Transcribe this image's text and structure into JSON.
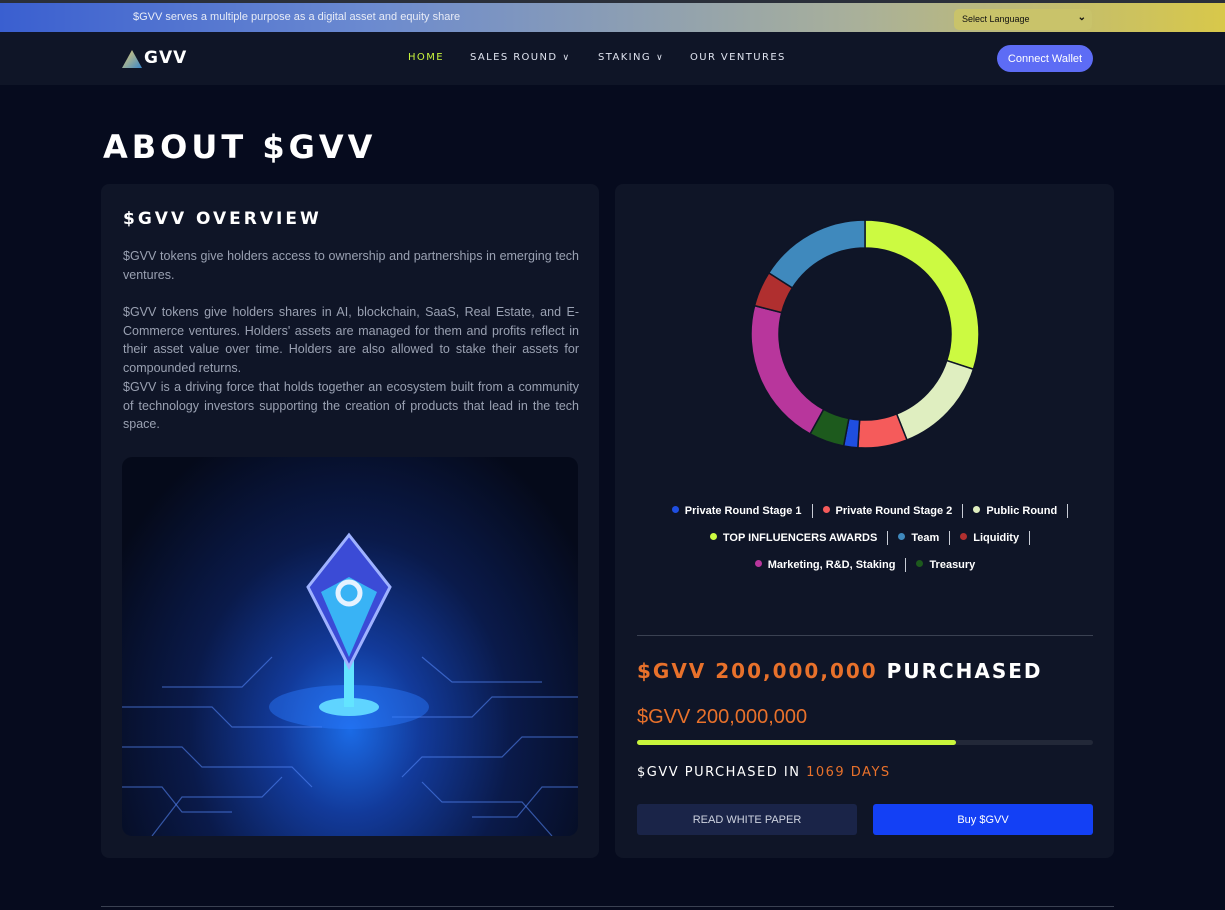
{
  "topbar": {
    "announcement": "$GVV serves a multiple purpose as a digital asset and equity share",
    "language_select": "Select Language"
  },
  "nav": {
    "logo_text": "GVV",
    "links": [
      {
        "label": "HOME",
        "active": true
      },
      {
        "label": "SALES ROUND",
        "dropdown": true
      },
      {
        "label": "STAKING",
        "dropdown": true
      },
      {
        "label": "OUR VENTURES"
      }
    ],
    "connect_label": "Connect Wallet"
  },
  "page": {
    "title": "ABOUT $GVV"
  },
  "overview": {
    "title": "$GVV OVERVIEW",
    "paragraphs": [
      "$GVV tokens give holders access to ownership and partnerships in emerging tech ventures.",
      "$GVV tokens give holders shares in AI, blockchain, SaaS, Real Estate, and E-Commerce ventures. Holders' assets are managed for them and profits reflect in their asset value over time. Holders are also allowed to stake their assets for compounded returns.",
      "$GVV is a driving force that holds together an ecosystem built from a community of technology investors supporting the creation of products that lead in the tech space."
    ]
  },
  "chart_data": {
    "type": "pie",
    "variant": "donut",
    "slices": [
      {
        "label": "TOP INFLUENCERS AWARDS",
        "value": 30,
        "color": "#ccfa41"
      },
      {
        "label": "Public Round",
        "value": 14,
        "color": "#dfeec0"
      },
      {
        "label": "Private Round Stage 2",
        "value": 7,
        "color": "#f55b5b"
      },
      {
        "label": "Private Round Stage 1",
        "value": 2,
        "color": "#1f4ee0"
      },
      {
        "label": "Treasury",
        "value": 5,
        "color": "#1d5a1d"
      },
      {
        "label": "Marketing, R&D, Staking",
        "value": 21,
        "color": "#b8369c"
      },
      {
        "label": "Liquidity",
        "value": 5,
        "color": "#b02f2f"
      },
      {
        "label": "Team",
        "value": 16,
        "color": "#3f89bd"
      }
    ]
  },
  "legend": {
    "rows": [
      [
        {
          "label": "Private Round Stage 1",
          "color": "#1f4ee0"
        },
        {
          "label": "Private Round Stage 2",
          "color": "#f55b5b"
        },
        {
          "label": "Public Round",
          "color": "#dfeec0"
        }
      ],
      [
        {
          "label": "TOP INFLUENCERS AWARDS",
          "color": "#ccfa41"
        },
        {
          "label": "Team",
          "color": "#3f89bd"
        },
        {
          "label": "Liquidity",
          "color": "#b02f2f"
        }
      ],
      [
        {
          "label": "Marketing, R&D, Staking",
          "color": "#b8369c"
        },
        {
          "label": "Treasury",
          "color": "#1d5a1d"
        }
      ]
    ]
  },
  "sale": {
    "purchased_amount": "$GVV 200,000,000",
    "purchased_word": "PURCHASED",
    "amount": "$GVV 200,000,000",
    "progress": 0.7,
    "purchased_in_label": "$GVV PURCHASED IN",
    "days": "1069 DAYS",
    "whitepaper_label": "READ WHITE PAPER",
    "buy_label": "Buy $GVV"
  },
  "colors": {
    "accent": "#c9f53c",
    "orange": "#e8712b",
    "primary_button": "#1340f5",
    "connect_button": "#5d6cf5"
  }
}
